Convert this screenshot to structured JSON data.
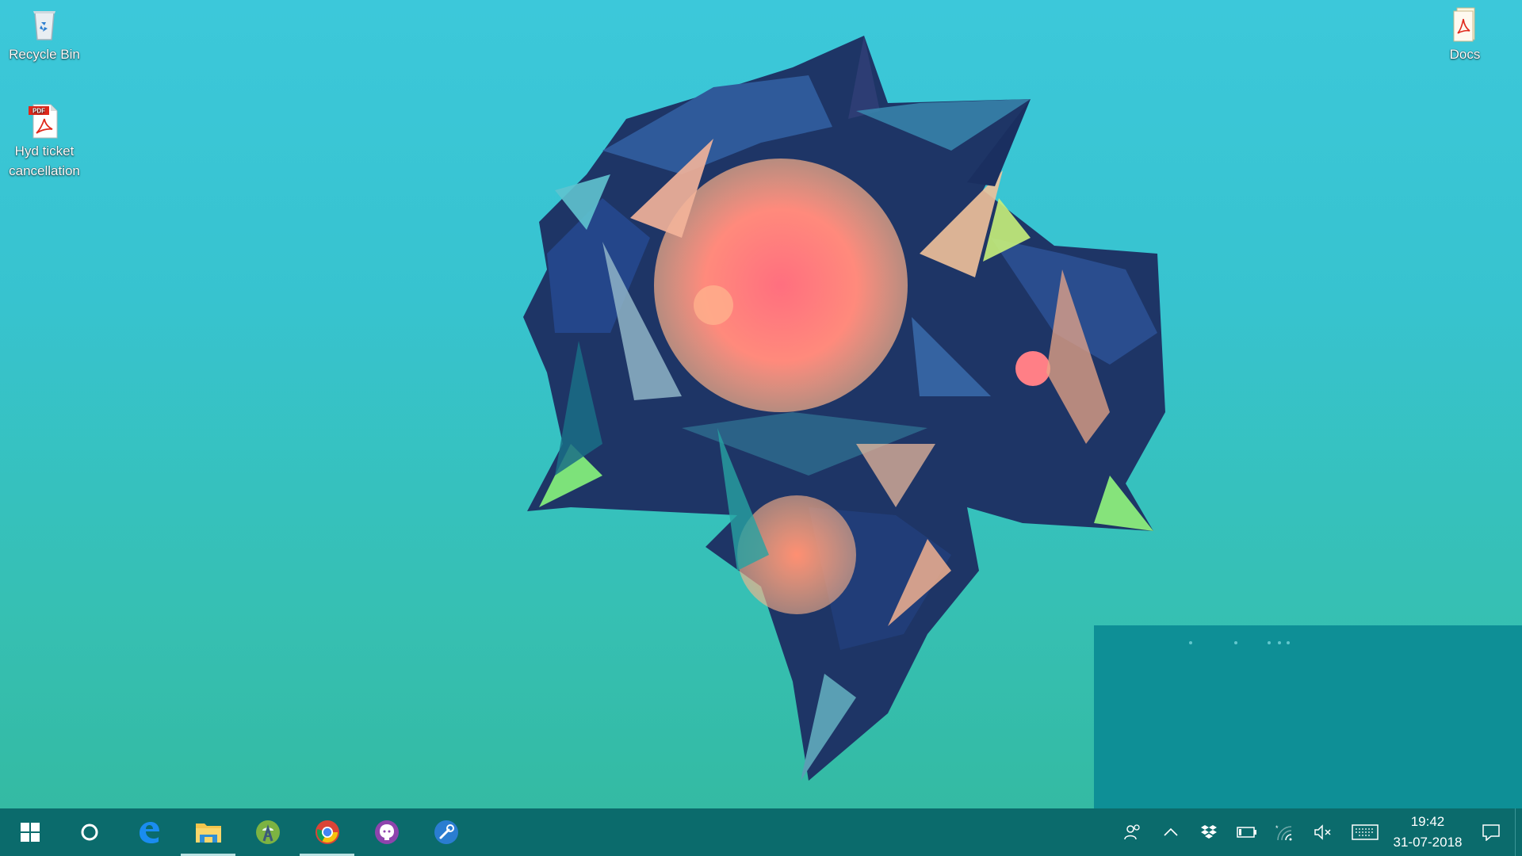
{
  "desktop": {
    "icons": [
      {
        "label": "Recycle Bin",
        "icon": "recycle-bin-icon"
      },
      {
        "label": "Hyd ticket cancellation",
        "icon": "pdf-file-icon",
        "badge": "PDF"
      },
      {
        "label": "Docs",
        "icon": "pdf-document-icon"
      }
    ],
    "accent": "#0b6b6c"
  },
  "taskbar": {
    "apps": [
      {
        "name": "start",
        "icon": "windows-logo-icon"
      },
      {
        "name": "cortana",
        "icon": "cortana-circle-icon"
      },
      {
        "name": "edge",
        "icon": "edge-browser-icon"
      },
      {
        "name": "file-explorer",
        "icon": "folder-icon",
        "active": true
      },
      {
        "name": "android-studio",
        "icon": "android-studio-icon"
      },
      {
        "name": "chrome",
        "icon": "chrome-icon",
        "active": true
      },
      {
        "name": "github-desktop",
        "icon": "github-icon"
      },
      {
        "name": "tool",
        "icon": "wrench-icon"
      }
    ],
    "tray": {
      "icons": [
        "people-icon",
        "chevron-up-icon",
        "dropbox-icon",
        "battery-icon",
        "wifi-icon",
        "volume-muted-icon",
        "keyboard-icon"
      ],
      "time": "19:42",
      "date": "31-07-2018",
      "notification_icon": "action-center-icon"
    }
  }
}
